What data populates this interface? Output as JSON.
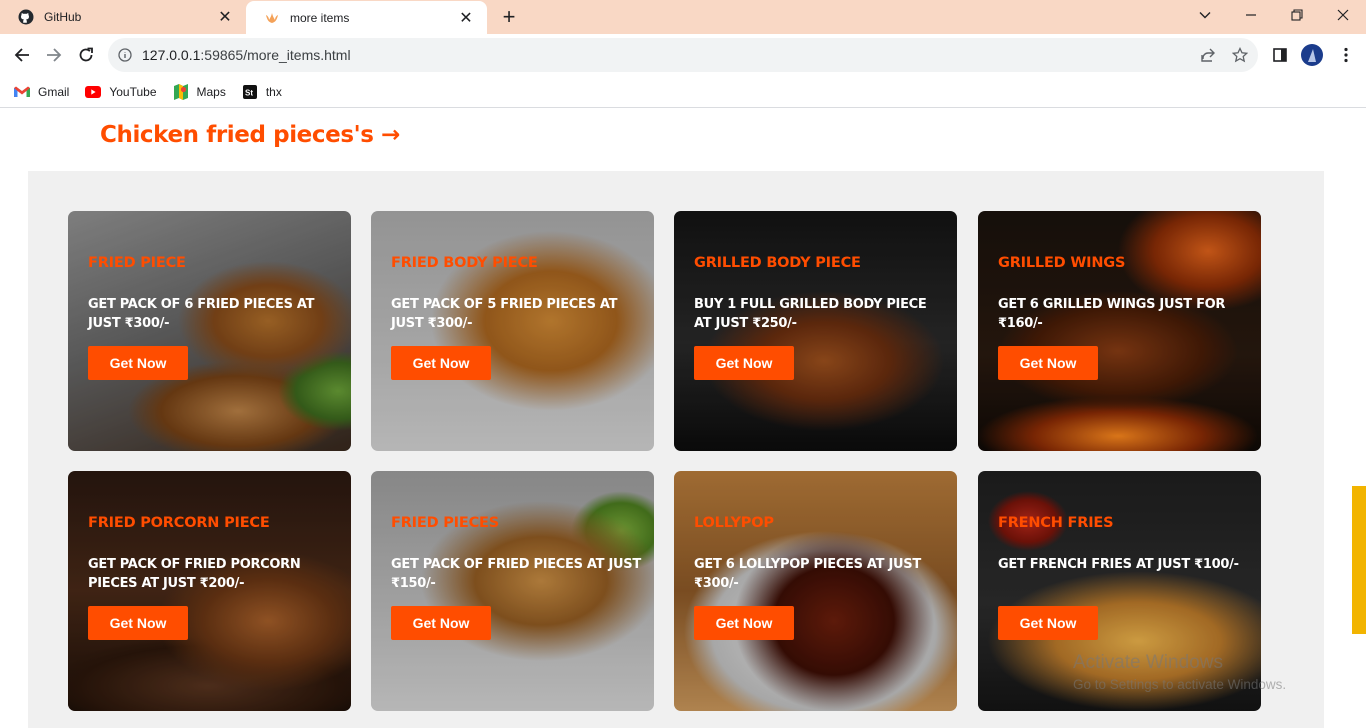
{
  "browser": {
    "tabs": [
      {
        "title": "GitHub",
        "icon": "github-icon",
        "active": false
      },
      {
        "title": "more items",
        "icon": "flame-icon",
        "active": true
      }
    ],
    "address": {
      "host": "127.0.0.1",
      "path": ":59865/more_items.html"
    },
    "bookmarks": [
      {
        "label": "Gmail",
        "icon": "gmail-icon"
      },
      {
        "label": "YouTube",
        "icon": "youtube-icon"
      },
      {
        "label": "Maps",
        "icon": "maps-icon"
      },
      {
        "label": "thx",
        "icon": "st-icon"
      }
    ]
  },
  "page": {
    "title": "Chicken fried pieces's →",
    "accent_color": "#ff4d00",
    "cards": [
      {
        "heading": "FRIED PIECE",
        "desc": "GET PACK OF 6 FRIED PIECES AT JUST ₹300/-",
        "button": "Get Now",
        "image": "fried-chicken-photo"
      },
      {
        "heading": "FRIED BODY PIECE",
        "desc": "GET PACK OF 5 FRIED PIECES AT JUST ₹300/-",
        "button": "Get Now",
        "image": "fried-body-piece-photo"
      },
      {
        "heading": "GRILLED BODY PIECE",
        "desc": "BUY 1 FULL GRILLED BODY PIECE AT JUST ₹250/-",
        "button": "Get Now",
        "image": "grilled-chicken-photo"
      },
      {
        "heading": "GRILLED WINGS",
        "desc": "GET 6 GRILLED WINGS JUST FOR ₹160/-",
        "button": "Get Now",
        "image": "grilled-wings-photo"
      },
      {
        "heading": "FRIED PORCORN PIECE",
        "desc": "GET PACK OF FRIED PORCORN PIECES AT JUST ₹200/-",
        "button": "Get Now",
        "image": "popcorn-chicken-photo"
      },
      {
        "heading": "FRIED PIECES",
        "desc": "GET PACK OF FRIED PIECES AT JUST ₹150/-",
        "button": "Get Now",
        "image": "fried-wings-photo"
      },
      {
        "heading": "LOLLYPOP",
        "desc": "GET 6 LOLLYPOP PIECES AT JUST ₹300/-",
        "button": "Get Now",
        "image": "lollipop-chicken-photo"
      },
      {
        "heading": "FRENCH FRIES",
        "desc": "GET FRENCH FRIES AT JUST ₹100/-",
        "button": "Get Now",
        "image": "french-fries-photo"
      }
    ]
  },
  "watermark": {
    "line1": "Activate Windows",
    "line2": "Go to Settings to activate Windows."
  }
}
